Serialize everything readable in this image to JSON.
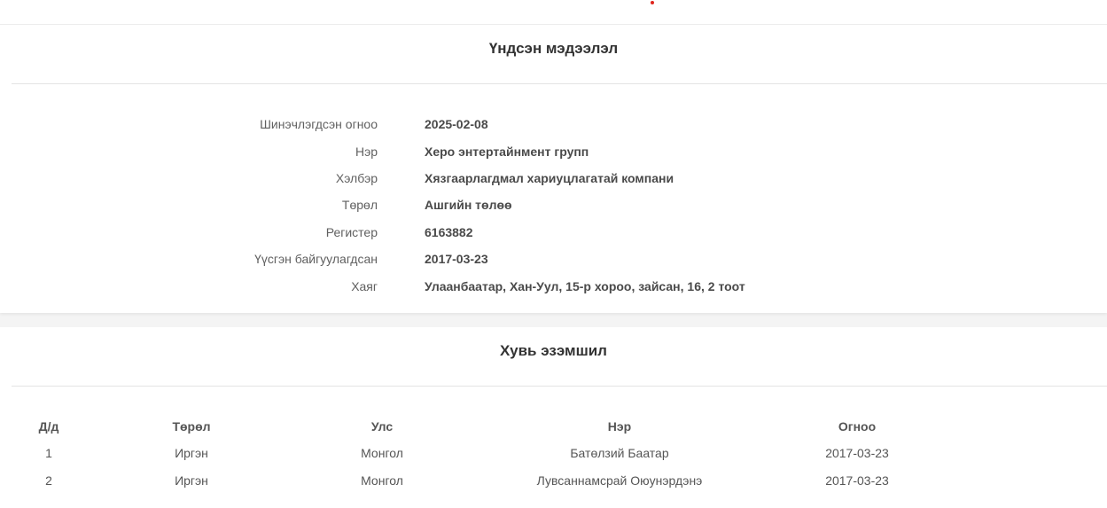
{
  "colors": {
    "accent_dot": "#e0261e"
  },
  "basic_info": {
    "title": "Үндсэн мэдээлэл",
    "rows": [
      {
        "label": "Шинэчлэгдсэн огноо",
        "value": "2025-02-08"
      },
      {
        "label": "Нэр",
        "value": "Херо энтертайнмент групп"
      },
      {
        "label": "Хэлбэр",
        "value": "Хязгаарлагдмал хариуцлагатай компани"
      },
      {
        "label": "Төрөл",
        "value": "Ашгийн төлөө"
      },
      {
        "label": "Регистер",
        "value": "6163882"
      },
      {
        "label": "Үүсгэн байгуулагдсан",
        "value": "2017-03-23"
      },
      {
        "label": "Хаяг",
        "value": "Улаанбаатар, Хан-Уул, 15-р хороо, зайсан, 16, 2 тоот"
      }
    ]
  },
  "ownership": {
    "title": "Хувь эзэмшил",
    "headers": [
      "Д/д",
      "Төрөл",
      "Улс",
      "Нэр",
      "Огноо"
    ],
    "rows": [
      [
        "1",
        "Иргэн",
        "Монгол",
        "Батөлзий Баатар",
        "2017-03-23"
      ],
      [
        "2",
        "Иргэн",
        "Монгол",
        "Лувсаннамсрай Оюунэрдэнэ",
        "2017-03-23"
      ]
    ]
  }
}
